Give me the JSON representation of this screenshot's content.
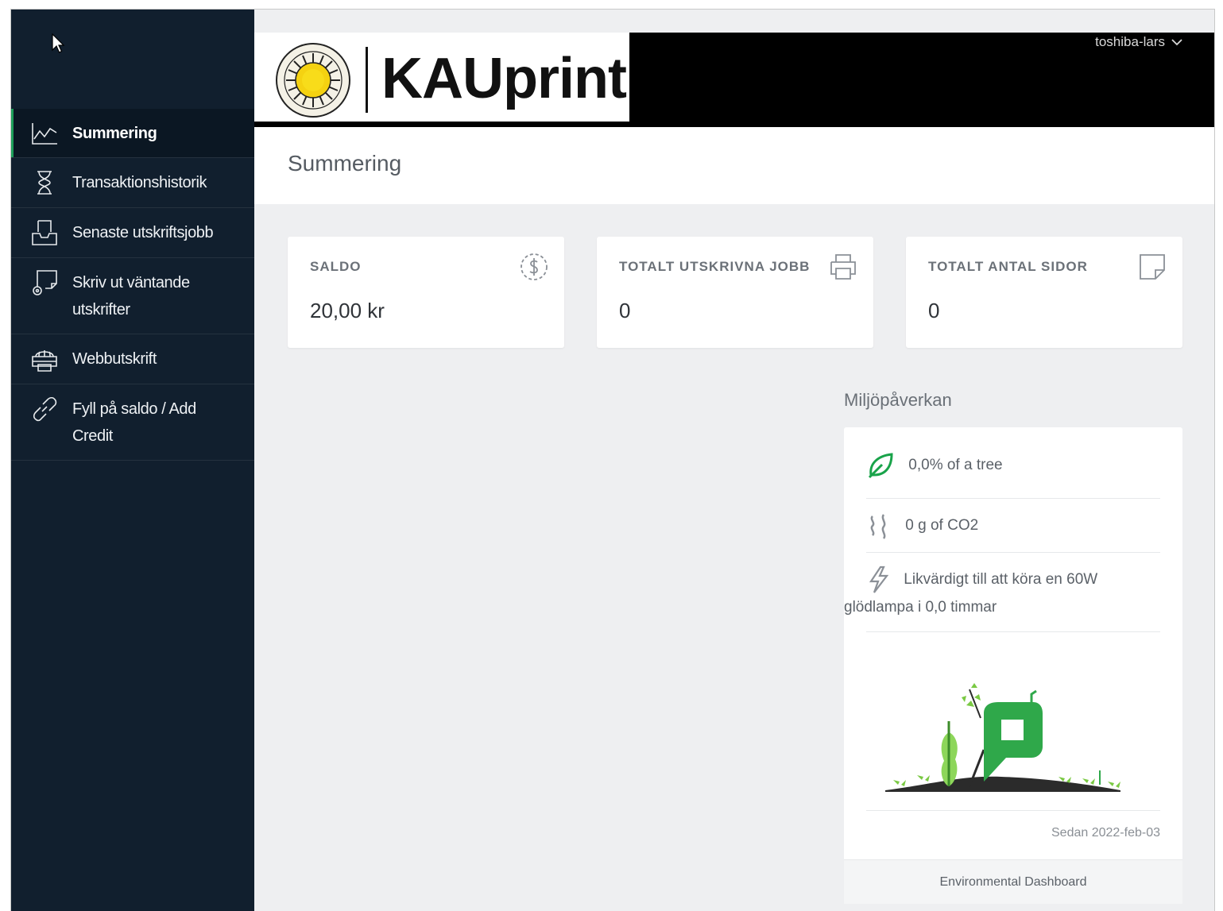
{
  "header": {
    "logo_text": "KAUprint",
    "seal_text": "KARLSTADS UNIVERSITET",
    "username": "toshiba-lars"
  },
  "sidebar": {
    "items": [
      {
        "label": "Summering",
        "icon": "chart-line-icon",
        "active": true
      },
      {
        "label": "Transaktionshistorik",
        "icon": "hourglass-icon"
      },
      {
        "label": "Senaste utskriftsjobb",
        "icon": "inbox-tray-icon"
      },
      {
        "label": "Skriv ut väntande",
        "label2": "utskrifter",
        "icon": "release-print-icon"
      },
      {
        "label": "Webbutskrift",
        "icon": "web-print-icon"
      },
      {
        "label": "Fyll på saldo / Add",
        "label2": "Credit",
        "icon": "link-icon"
      }
    ]
  },
  "page": {
    "title": "Summering"
  },
  "cards": [
    {
      "label": "SALDO",
      "value": "20,00 kr",
      "icon": "dollar-coin-icon"
    },
    {
      "label": "TOTALT UTSKRIVNA JOBB",
      "value": "0",
      "icon": "printer-icon"
    },
    {
      "label": "TOTALT ANTAL SIDOR",
      "value": "0",
      "icon": "page-icon"
    }
  ],
  "environment": {
    "heading": "Miljöpåverkan",
    "tree": "0,0% of a tree",
    "co2": "0 g of CO2",
    "energy_line1": "Likvärdigt till att köra en 60W",
    "energy_line2": "glödlampa i 0,0 timmar",
    "since": "Sedan 2022-feb-03",
    "footer_link": "Environmental Dashboard"
  },
  "colors": {
    "sidebar_bg": "#111f2e",
    "active_accent": "#1e9e5a",
    "header_bg": "#000000",
    "page_bg": "#eeeff1",
    "eco_green": "#19a34a"
  }
}
